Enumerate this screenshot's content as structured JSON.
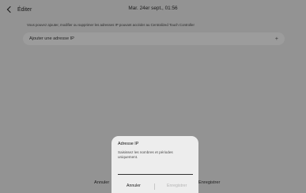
{
  "header": {
    "back_label": "Éditer",
    "datetime": "Mar. 24er sept., 01:56"
  },
  "main": {
    "info_text": "Vous pouvez ajouter, modifier ou supprimer les adresses IP pouvant accéder au Centralized Touch Controller",
    "add_ip_label": "Ajouter une adresse IP",
    "add_icon": "plus-icon"
  },
  "bottom": {
    "cancel_label": "Annuler",
    "save_label": "Enregistrer"
  },
  "dialog": {
    "title": "Adresse IP",
    "helper": "Saisissez les nombres et périodes uniquement.",
    "input_value": "",
    "cancel_label": "Annuler",
    "save_label": "Enregistrer"
  },
  "colors": {
    "overlay_bg": "#939393",
    "dialog_bg": "#ededed",
    "disabled_text": "#b4b4b4"
  }
}
